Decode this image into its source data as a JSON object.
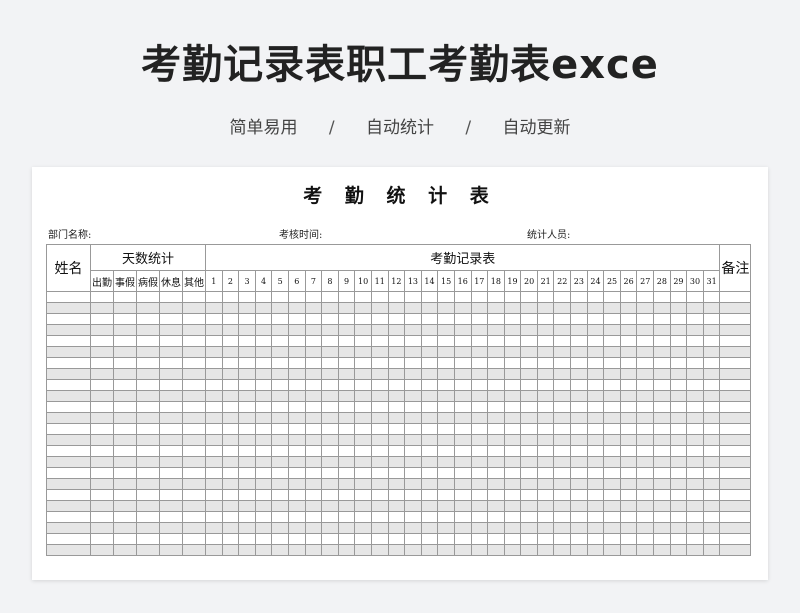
{
  "header": {
    "title": "考勤记录表职工考勤表exce",
    "taglines": [
      "简单易用",
      "自动统计",
      "自动更新"
    ],
    "separator": "/"
  },
  "sheet": {
    "title": "考 勤 统 计 表",
    "info": {
      "department": "部门名称:",
      "period": "考核时间:",
      "counter": "统计人员:"
    },
    "table": {
      "name_header": "姓名",
      "stats_header": "天数统计",
      "stats_columns": [
        "出勤",
        "事假",
        "病假",
        "休息",
        "其他"
      ],
      "record_header": "考勤记录表",
      "days": [
        "1",
        "2",
        "3",
        "4",
        "5",
        "6",
        "7",
        "8",
        "9",
        "10",
        "11",
        "12",
        "13",
        "14",
        "15",
        "16",
        "17",
        "18",
        "19",
        "20",
        "21",
        "22",
        "23",
        "24",
        "25",
        "26",
        "27",
        "28",
        "29",
        "30",
        "31"
      ],
      "remarks_header": "备注",
      "empty_rows": 24
    }
  }
}
